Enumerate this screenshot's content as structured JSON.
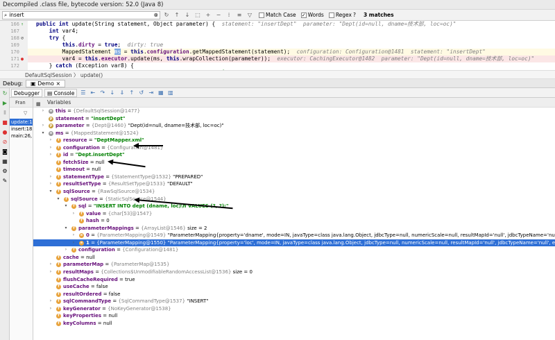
{
  "window": {
    "title": "Decompiled .class file, bytecode version: 52.0 (Java 8)"
  },
  "find": {
    "query": "insert",
    "match_case": "Match Case",
    "words": "Words",
    "regex": "Regex",
    "regex_hint": "?",
    "matches": "3 matches"
  },
  "editor": {
    "lines": [
      {
        "num": "166",
        "icon": "green-arrow-icon",
        "parts": [
          [
            "kw",
            "public int "
          ],
          [
            "n",
            "update(String statement, Object parameter) {  "
          ],
          [
            "hint",
            "statement: \"insertDept\"  parameter: \"Dept(id=null, dname=技术部, loc=oc)\""
          ]
        ]
      },
      {
        "num": "167",
        "icon": "",
        "parts": [
          [
            "n",
            "    "
          ],
          [
            "kw",
            "int "
          ],
          [
            "n",
            "var4;"
          ]
        ]
      },
      {
        "num": "168",
        "icon": "no-entry-icon",
        "parts": [
          [
            "n",
            "    "
          ],
          [
            "kw",
            "try "
          ],
          [
            "n",
            "{"
          ]
        ]
      },
      {
        "num": "169",
        "icon": "",
        "parts": [
          [
            "n",
            "        "
          ],
          [
            "kw",
            "this"
          ],
          [
            "n",
            "."
          ],
          [
            "fld",
            "dirty"
          ],
          [
            "n",
            " = "
          ],
          [
            "kw",
            "true"
          ],
          [
            "n",
            ";  "
          ],
          [
            "hint",
            "dirty: true"
          ]
        ]
      },
      {
        "num": "170",
        "icon": "",
        "hl": "hl",
        "parts": [
          [
            "n",
            "        MappedStatement "
          ],
          [
            "n",
            "ms"
          ],
          [
            "n",
            " = "
          ],
          [
            "kw",
            "this"
          ],
          [
            "n",
            "."
          ],
          [
            "fld",
            "configuration"
          ],
          [
            "n",
            ".getMappedStatement(statement);  "
          ],
          [
            "hint",
            "configuration: Configuration@1481  statement: \"insertDept\""
          ]
        ]
      },
      {
        "num": "171",
        "icon": "breakpoint-icon",
        "hl": "err",
        "parts": [
          [
            "n",
            "        var4 = "
          ],
          [
            "kw",
            "this"
          ],
          [
            "n",
            "."
          ],
          [
            "fld",
            "executor"
          ],
          [
            "n",
            ".update(ms, "
          ],
          [
            "kw",
            "this"
          ],
          [
            "n",
            ".wrapCollection(parameter));  "
          ],
          [
            "hint",
            "executor: CachingExecutor@1482  parameter: \"Dept(id=null, dname=技术部, loc=oc)\""
          ]
        ]
      },
      {
        "num": "172",
        "icon": "",
        "parts": [
          [
            "n",
            "    } "
          ],
          [
            "kw",
            "catch "
          ],
          [
            "n",
            "(Exception var8) {"
          ]
        ]
      },
      {
        "num": "173",
        "icon": "",
        "parts": [
          [
            "n",
            "        "
          ],
          [
            "kw",
            "throw "
          ],
          [
            "n",
            "ExceptionFactory.wrapException("
          ],
          [
            "str",
            "\"Error updating database.  Cause: \""
          ],
          [
            "n",
            " + var8, var8);"
          ]
        ]
      }
    ]
  },
  "breadcrumb": {
    "text": "DefaultSqlSession  〉  update()"
  },
  "debug": {
    "label": "Debug:",
    "session": "Demo"
  },
  "toolbar": {
    "debugger": "Debugger",
    "console": "Console"
  },
  "frames": {
    "header": "Fran",
    "items": [
      {
        "label": "update:1",
        "selected": true
      },
      {
        "label": "insert:185",
        "selected": false
      },
      {
        "label": "main:26, I",
        "selected": false
      }
    ]
  },
  "variables": {
    "header": "Variables",
    "rows": [
      {
        "d": 0,
        "a": "r",
        "b": "",
        "nm": "this",
        "tp": "{DefaultSqlSession@1477}",
        "val": ""
      },
      {
        "d": 0,
        "a": "",
        "b": "p",
        "nm": "statement",
        "tp": "",
        "val": "\"insertDept\"",
        "s": true
      },
      {
        "d": 0,
        "a": "r",
        "b": "p",
        "nm": "parameter",
        "tp": "{Dept@1460}",
        "val": "\"Dept(id=null, dname=技术部, loc=oc)\""
      },
      {
        "d": 0,
        "a": "d",
        "b": "",
        "nm": "ms",
        "tp": "{MappedStatement@1524}",
        "val": ""
      },
      {
        "d": 1,
        "a": "r",
        "b": "f",
        "nm": "resource",
        "tp": "",
        "val": "\"DeptMapper.xml\"",
        "s": true
      },
      {
        "d": 1,
        "a": "r",
        "b": "f",
        "nm": "configuration",
        "tp": "{Configuration@1481}",
        "val": ""
      },
      {
        "d": 1,
        "a": "r",
        "b": "f",
        "nm": "id",
        "tp": "",
        "val": "\"Dept.insertDept\"",
        "s": true
      },
      {
        "d": 1,
        "a": "",
        "b": "f",
        "nm": "fetchSize",
        "tp": "",
        "val": "null"
      },
      {
        "d": 1,
        "a": "",
        "b": "f",
        "nm": "timeout",
        "tp": "",
        "val": "null"
      },
      {
        "d": 1,
        "a": "r",
        "b": "f",
        "nm": "statementType",
        "tp": "{StatementType@1532}",
        "val": "\"PREPARED\""
      },
      {
        "d": 1,
        "a": "r",
        "b": "f",
        "nm": "resultSetType",
        "tp": "{ResultSetType@1533}",
        "val": "\"DEFAULT\""
      },
      {
        "d": 1,
        "a": "d",
        "b": "f",
        "nm": "sqlSource",
        "tp": "{RawSqlSource@1534}",
        "val": ""
      },
      {
        "d": 2,
        "a": "d",
        "b": "f",
        "nm": "sqlSource",
        "tp": "{StaticSqlSource@1544}",
        "val": ""
      },
      {
        "d": 3,
        "a": "d",
        "b": "f",
        "nm": "sql",
        "tp": "",
        "val": "\"INSERT INTO dept (dname, loc)\\n         VALUES (?, ?);\"",
        "s": true
      },
      {
        "d": 4,
        "a": "r",
        "b": "f",
        "nm": "value",
        "tp": "{char[53]@1547}",
        "val": ""
      },
      {
        "d": 4,
        "a": "",
        "b": "f",
        "nm": "hash",
        "tp": "",
        "val": "0"
      },
      {
        "d": 3,
        "a": "d",
        "b": "f",
        "nm": "parameterMappings",
        "tp": "{ArrayList@1546}",
        "val": "size = 2"
      },
      {
        "d": 4,
        "a": "r",
        "b": "l",
        "nm": "0",
        "tp": "{ParameterMapping@1549}",
        "val": "\"ParameterMapping{property='dname', mode=IN, javaType=class java.lang.Object, jdbcType=null, numericScale=null, resultMapId='null', jdbcTypeName='null', expression='null'}\""
      },
      {
        "d": 4,
        "a": "r",
        "b": "l",
        "nm": "1",
        "tp": "{ParameterMapping@1550}",
        "val": "\"ParameterMapping{property='loc', mode=IN, javaType=class java.lang.Object, jdbcType=null, numericScale=null, resultMapId='null', jdbcTypeName='null', expression='null'}\"",
        "sel": true
      },
      {
        "d": 3,
        "a": "r",
        "b": "f",
        "nm": "configuration",
        "tp": "{Configuration@1481}",
        "val": ""
      },
      {
        "d": 1,
        "a": "",
        "b": "f",
        "nm": "cache",
        "tp": "",
        "val": "null"
      },
      {
        "d": 1,
        "a": "r",
        "b": "f",
        "nm": "parameterMap",
        "tp": "{ParameterMap@1535}",
        "val": ""
      },
      {
        "d": 1,
        "a": "r",
        "b": "f",
        "nm": "resultMaps",
        "tp": "{Collections$UnmodifiableRandomAccessList@1536}",
        "val": "size = 0"
      },
      {
        "d": 1,
        "a": "",
        "b": "f",
        "nm": "flushCacheRequired",
        "tp": "",
        "val": "true"
      },
      {
        "d": 1,
        "a": "",
        "b": "f",
        "nm": "useCache",
        "tp": "",
        "val": "false"
      },
      {
        "d": 1,
        "a": "",
        "b": "f",
        "nm": "resultOrdered",
        "tp": "",
        "val": "false"
      },
      {
        "d": 1,
        "a": "r",
        "b": "f",
        "nm": "sqlCommandType",
        "tp": "{SqlCommandType@1537}",
        "val": "\"INSERT\""
      },
      {
        "d": 1,
        "a": "r",
        "b": "f",
        "nm": "keyGenerator",
        "tp": "{NoKeyGenerator@1538}",
        "val": ""
      },
      {
        "d": 1,
        "a": "",
        "b": "f",
        "nm": "keyProperties",
        "tp": "",
        "val": "null"
      },
      {
        "d": 1,
        "a": "",
        "b": "f",
        "nm": "keyColumns",
        "tp": "",
        "val": "null"
      }
    ]
  },
  "colors": {
    "selection": "#2e6fd6",
    "keyword": "#000080",
    "string": "#008000",
    "field": "#660e7a",
    "badge": "#e8a33c"
  }
}
